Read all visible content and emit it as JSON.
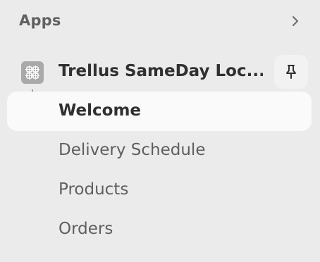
{
  "header": {
    "title": "Apps",
    "expand_icon": "chevron-right-icon"
  },
  "app": {
    "name": "Trellus SameDay Loc...",
    "icon": "app-grid-icon",
    "pin_icon": "pin-icon"
  },
  "nav": {
    "connector_icon": "arrow-corner-down-right-icon",
    "items": [
      {
        "label": "Welcome",
        "active": true
      },
      {
        "label": "Delivery Schedule",
        "active": false
      },
      {
        "label": "Products",
        "active": false
      },
      {
        "label": "Orders",
        "active": false
      }
    ]
  },
  "colors": {
    "background": "#ebebeb",
    "active_bg": "#fafafa",
    "text_primary": "#303030",
    "text_secondary": "#5f5f5f",
    "icon_gray": "#a9a9a9"
  }
}
